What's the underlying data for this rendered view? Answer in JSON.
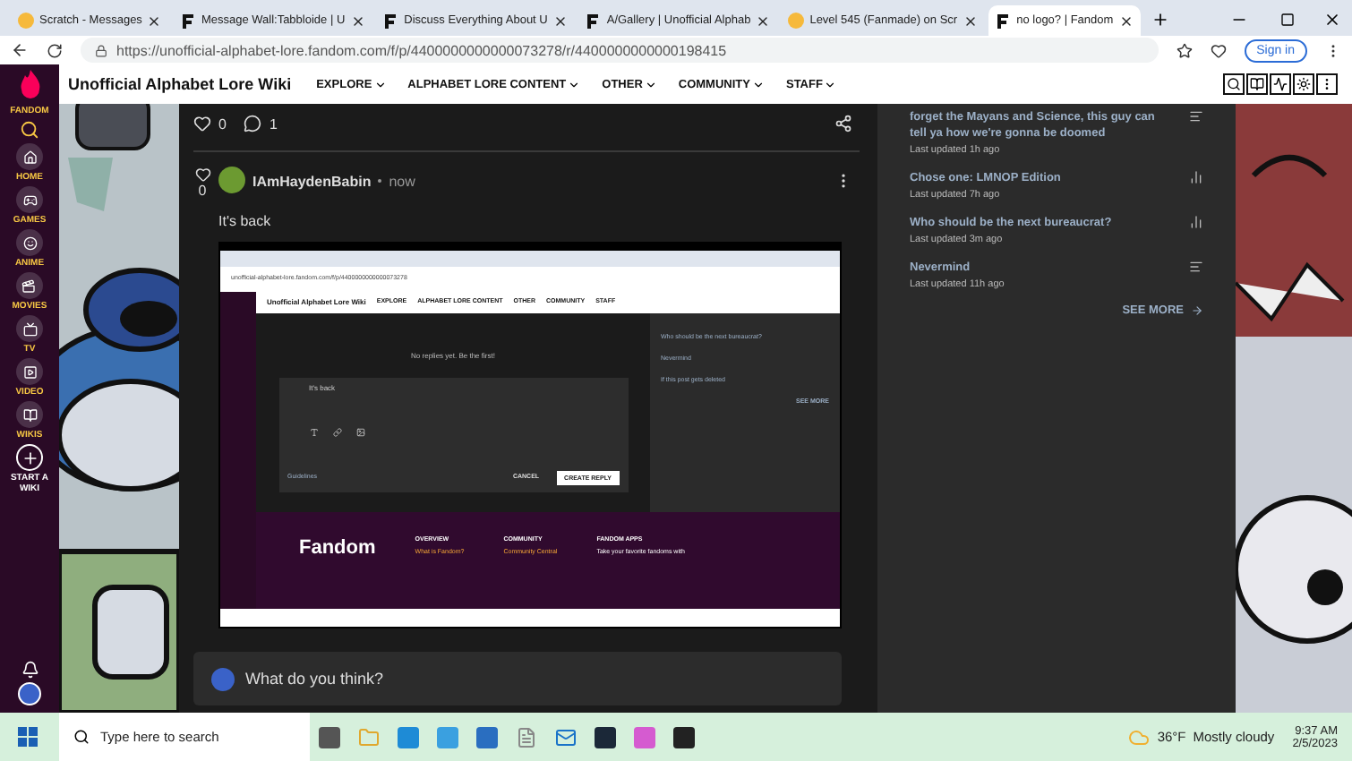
{
  "browser": {
    "tabs": [
      {
        "title": "Scratch - Messages",
        "kind": "scratch",
        "selected": false
      },
      {
        "title": "Message Wall:Tabbloide | U",
        "kind": "fandom",
        "selected": false
      },
      {
        "title": "Discuss Everything About U",
        "kind": "fandom",
        "selected": false
      },
      {
        "title": "A/Gallery | Unofficial Alphab",
        "kind": "fandom",
        "selected": false
      },
      {
        "title": "Level 545 (Fanmade) on Scr",
        "kind": "scratch",
        "selected": false
      },
      {
        "title": "no logo? | Fandom",
        "kind": "fandom",
        "selected": true
      }
    ],
    "url": "https://unofficial-alphabet-lore.fandom.com/f/p/4400000000000073278/r/4400000000000198415",
    "sign_in": "Sign in"
  },
  "wiki": {
    "name": "Unofficial Alphabet Lore Wiki",
    "nav": [
      "EXPLORE",
      "ALPHABET LORE CONTENT",
      "OTHER",
      "COMMUNITY",
      "STAFF"
    ]
  },
  "rail": {
    "brand": "FANDOM",
    "items": [
      {
        "kind": "section",
        "label": "HOME"
      },
      {
        "kind": "section",
        "label": "GAMES"
      },
      {
        "kind": "section",
        "label": "ANIME"
      },
      {
        "kind": "section",
        "label": "MOVIES"
      },
      {
        "kind": "section",
        "label": "TV"
      },
      {
        "kind": "section",
        "label": "VIDEO"
      },
      {
        "kind": "section",
        "label": "WIKIS"
      },
      {
        "kind": "create",
        "label": "START A WIKI"
      }
    ]
  },
  "post": {
    "likes": "0",
    "replies": "1"
  },
  "reply": {
    "author": "IAmHaydenBabin",
    "time": "now",
    "likes": "0",
    "text": "It's back",
    "attachment": {
      "url": "unofficial-alphabet-lore.fandom.com/f/p/4400000000000073278",
      "wiki_name": "Unofficial Alphabet Lore Wiki",
      "nav": [
        "EXPLORE",
        "ALPHABET LORE CONTENT",
        "OTHER",
        "COMMUNITY",
        "STAFF"
      ],
      "empty": "No replies yet. Be the first!",
      "draft": "It's back",
      "guidelines": "Guidelines",
      "cancel": "CANCEL",
      "create": "CREATE REPLY",
      "side_items": [
        "Who should be the next bureaucrat?",
        "Nevermind",
        "If this post gets deleted"
      ],
      "see_more": "SEE MORE",
      "footer": {
        "logo": "Fandom",
        "columns": [
          {
            "heading": "OVERVIEW",
            "link": "What is Fandom?"
          },
          {
            "heading": "COMMUNITY",
            "link": "Community Central"
          },
          {
            "heading": "FANDOM APPS",
            "link": "Take your favorite fandoms with"
          }
        ]
      }
    }
  },
  "comment_box": {
    "placeholder": "What do you think?"
  },
  "sidebar": {
    "items": [
      {
        "title": "forget the Mayans and Science, this guy can tell ya how we're gonna be doomed",
        "updated": "Last updated 1h ago",
        "kind": "post"
      },
      {
        "title": "Chose one: LMNOP Edition",
        "updated": "Last updated 7h ago",
        "kind": "poll"
      },
      {
        "title": "Who should be the next bureaucrat?",
        "updated": "Last updated 3m ago",
        "kind": "poll"
      },
      {
        "title": "Nevermind",
        "updated": "Last updated 11h ago",
        "kind": "post"
      }
    ],
    "see_more": "SEE MORE"
  },
  "taskbar": {
    "search_placeholder": "Type here to search",
    "temperature": "36°F",
    "condition": "Mostly cloudy",
    "time": "9:37 AM",
    "date": "2/5/2023"
  }
}
